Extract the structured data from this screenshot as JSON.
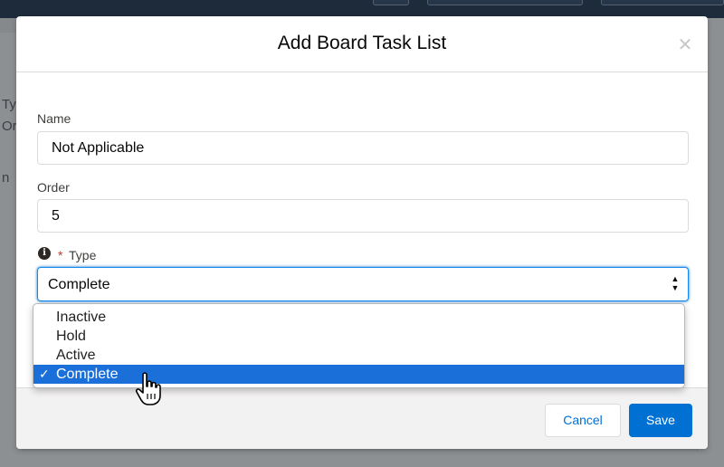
{
  "background": {
    "partial_text_1": "Ty",
    "partial_text_2": "Or",
    "partial_text_3": "n"
  },
  "modal": {
    "title": "Add Board Task List",
    "close_icon": "close-icon",
    "name_field": {
      "label": "Name",
      "value": "Not Applicable"
    },
    "order_field": {
      "label": "Order",
      "value": "5"
    },
    "type_field": {
      "label": "Type",
      "required_mark": "*",
      "info_icon": "info-icon",
      "selected_value": "Complete",
      "options": [
        "Inactive",
        "Hold",
        "Active",
        "Complete"
      ]
    },
    "footer": {
      "cancel_label": "Cancel",
      "save_label": "Save"
    }
  },
  "dropdown": {
    "check_mark": "✓"
  },
  "colors": {
    "brand": "#0070d2",
    "selected_option": "#1a6fd8",
    "required": "#c23934"
  }
}
